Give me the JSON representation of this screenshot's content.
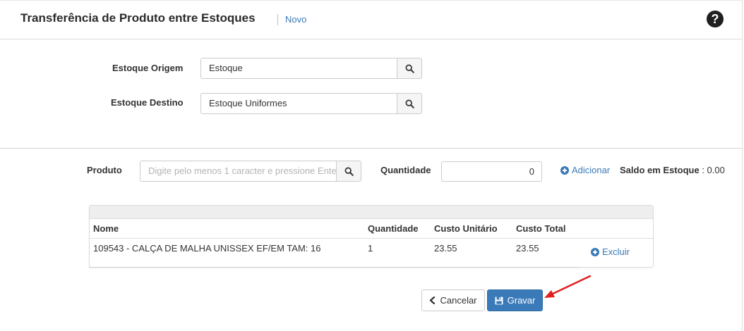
{
  "header": {
    "title": "Transferência de Produto entre Estoques",
    "subtitle": "Novo",
    "help_icon": "question-circle-icon"
  },
  "form": {
    "origem_label": "Estoque Origem",
    "origem_value": "Estoque",
    "destino_label": "Estoque Destino",
    "destino_value": "Estoque Uniformes"
  },
  "produto": {
    "label": "Produto",
    "placeholder": "Digite pelo menos 1 caracter e pressione Ente",
    "quantidade_label": "Quantidade",
    "quantidade_value": "0",
    "add_link": "Adicionar",
    "saldo_label": "Saldo em Estoque",
    "saldo_value": ": 0.00"
  },
  "table": {
    "columns": [
      "Nome",
      "Quantidade",
      "Custo Unitário",
      "Custo Total"
    ],
    "rows": [
      {
        "nome": "109543 - CALÇA DE MALHA UNISSEX EF/EM TAM: 16",
        "quantidade": "1",
        "custo_unitario": "23.55",
        "custo_total": "23.55",
        "action": "Excluir"
      }
    ]
  },
  "buttons": {
    "cancel": "Cancelar",
    "save": "Gravar"
  },
  "colors": {
    "link": "#3a7ab8",
    "primary": "#3a7ab8",
    "annotation_arrow": "#e02020"
  }
}
